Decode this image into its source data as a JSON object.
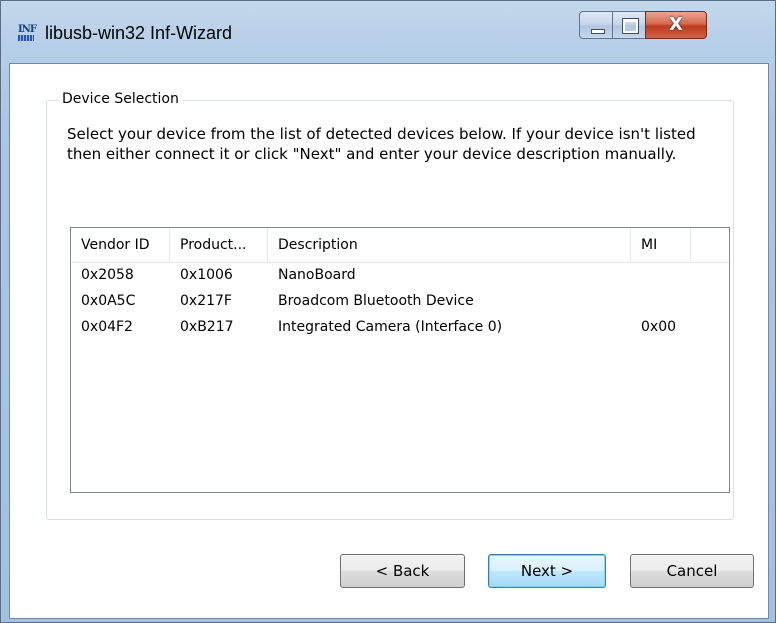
{
  "window": {
    "title": "libusb-win32 Inf-Wizard",
    "icon_label": "INF",
    "close_glyph": "X"
  },
  "group": {
    "legend": "Device Selection"
  },
  "instructions": "Select your device from the list of detected devices below. If your device isn't listed then either connect it or click \"Next\" and enter your device description manually.",
  "device_list": {
    "columns": [
      "Vendor ID",
      "Product...",
      "Description",
      "MI",
      ""
    ],
    "rows": [
      {
        "vendor_id": "0x2058",
        "product_id": "0x1006",
        "description": "NanoBoard",
        "mi": ""
      },
      {
        "vendor_id": "0x0A5C",
        "product_id": "0x217F",
        "description": "Broadcom Bluetooth Device",
        "mi": ""
      },
      {
        "vendor_id": "0x04F2",
        "product_id": "0xB217",
        "description": "Integrated Camera (Interface 0)",
        "mi": "0x00"
      }
    ]
  },
  "buttons": {
    "back": "< Back",
    "next": "Next >",
    "cancel": "Cancel"
  },
  "icons": {
    "app": "inf-wizard-icon",
    "minimize": "minimize-icon",
    "maximize": "maximize-icon",
    "close": "close-icon"
  },
  "colors": {
    "frame": "#b7cfe8",
    "close_button": "#c0391d",
    "default_button_border": "#3c7fb1"
  }
}
